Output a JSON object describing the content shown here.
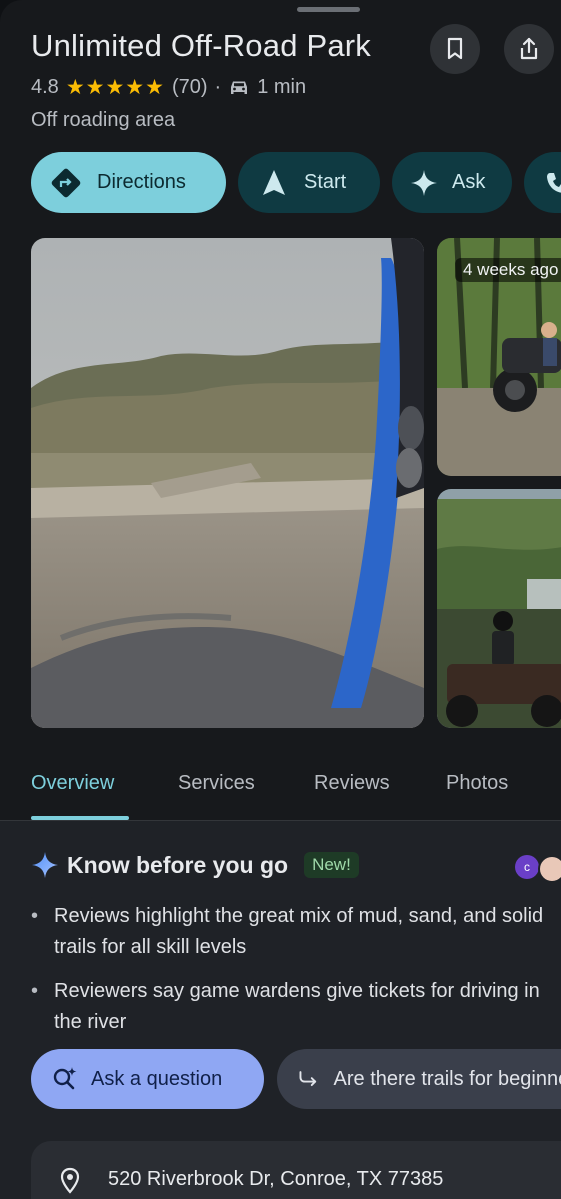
{
  "place": {
    "name": "Unlimited Off-Road Park",
    "rating": "4.8",
    "stars": "★★★★★",
    "review_count": "(70)",
    "separator": "·",
    "drive_time": "1 min",
    "category": "Off roading area"
  },
  "header_actions": {
    "save_icon": "bookmark-icon",
    "share_icon": "share-icon"
  },
  "actions": [
    {
      "label": "Directions",
      "icon": "directions-icon"
    },
    {
      "label": "Start",
      "icon": "navigation-arrow-icon"
    },
    {
      "label": "Ask",
      "icon": "sparkle-icon"
    },
    {
      "label": "",
      "icon": "phone-icon"
    }
  ],
  "photos": {
    "side_top_badge": "4 weeks ago"
  },
  "tabs": [
    {
      "label": "Overview",
      "active": true
    },
    {
      "label": "Services",
      "active": false
    },
    {
      "label": "Reviews",
      "active": false
    },
    {
      "label": "Photos",
      "active": false
    }
  ],
  "summary": {
    "title": "Know before you go",
    "badge": "New!",
    "avatar_initial": "c",
    "bullets": [
      "Reviews highlight the great mix of mud, sand, and solid trails for all skill levels",
      "Reviewers say game wardens give tickets for driving in the river"
    ]
  },
  "suggestions": {
    "ask_label": "Ask a question",
    "prompt_label": "Are there trails for beginners?"
  },
  "address": {
    "text": "520 Riverbrook Dr, Conroe, TX 77385",
    "icon": "location-pin-icon"
  },
  "colors": {
    "accent": "#7dcfdc",
    "star": "#fbbc04",
    "ask_pill": "#8fa7f3",
    "background": "#17191c"
  }
}
